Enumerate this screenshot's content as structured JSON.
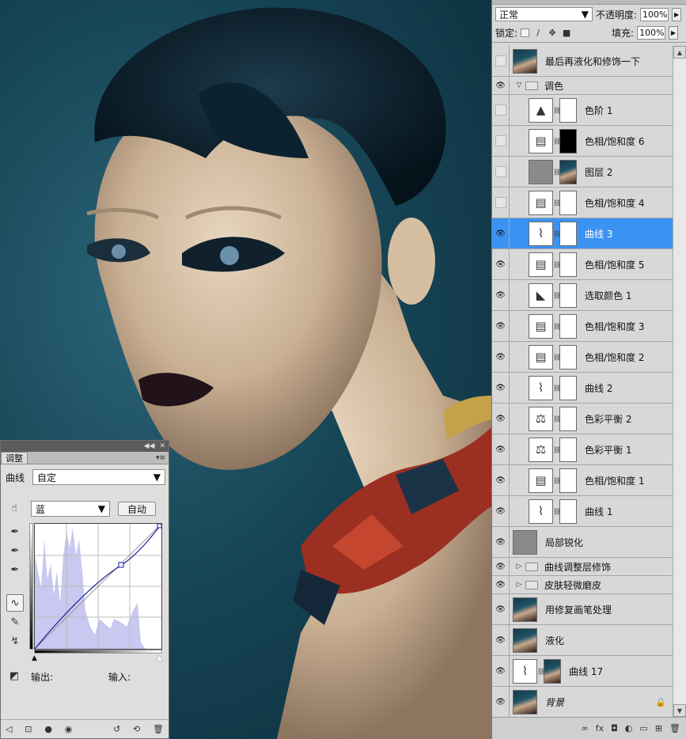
{
  "layers_panel": {
    "blend_mode": "正常",
    "opacity_label": "不透明度:",
    "opacity_value": "100%",
    "lock_label": "锁定:",
    "fill_label": "填充:",
    "fill_value": "100%",
    "layers": [
      {
        "name": "最后再液化和修饰一下",
        "visible": false,
        "kind": "photo"
      },
      {
        "name": "调色",
        "visible": true,
        "kind": "group-open"
      },
      {
        "name": "色阶 1",
        "visible": false,
        "kind": "levels",
        "in_group": true
      },
      {
        "name": "色相/饱和度 6",
        "visible": false,
        "kind": "hue",
        "in_group": true,
        "mask": "black"
      },
      {
        "name": "图层 2",
        "visible": false,
        "kind": "gray",
        "in_group": true,
        "mask": "photo"
      },
      {
        "name": "色相/饱和度 4",
        "visible": false,
        "kind": "hue",
        "in_group": true,
        "mask": "white"
      },
      {
        "name": "曲线 3",
        "visible": true,
        "kind": "curves",
        "in_group": true,
        "selected": true
      },
      {
        "name": "色相/饱和度 5",
        "visible": true,
        "kind": "hue",
        "in_group": true
      },
      {
        "name": "选取颜色 1",
        "visible": true,
        "kind": "selective",
        "in_group": true
      },
      {
        "name": "色相/饱和度 3",
        "visible": true,
        "kind": "hue",
        "in_group": true
      },
      {
        "name": "色相/饱和度 2",
        "visible": true,
        "kind": "hue",
        "in_group": true
      },
      {
        "name": "曲线 2",
        "visible": true,
        "kind": "curves",
        "in_group": true
      },
      {
        "name": "色彩平衡 2",
        "visible": true,
        "kind": "balance",
        "in_group": true
      },
      {
        "name": "色彩平衡 1",
        "visible": true,
        "kind": "balance",
        "in_group": true
      },
      {
        "name": "色相/饱和度 1",
        "visible": true,
        "kind": "hue",
        "in_group": true
      },
      {
        "name": "曲线 1",
        "visible": true,
        "kind": "curves",
        "in_group": true
      },
      {
        "name": "局部锐化",
        "visible": true,
        "kind": "gray"
      },
      {
        "name": "曲线调整层修饰",
        "visible": true,
        "kind": "group-closed"
      },
      {
        "name": "皮肤轻微磨皮",
        "visible": true,
        "kind": "group-closed"
      },
      {
        "name": "用修复画笔处理",
        "visible": true,
        "kind": "photo"
      },
      {
        "name": "液化",
        "visible": true,
        "kind": "photo"
      },
      {
        "name": "曲线 17",
        "visible": true,
        "kind": "curves",
        "mask": "photo"
      },
      {
        "name": "背景",
        "visible": true,
        "kind": "photo",
        "locked": true
      }
    ]
  },
  "adjustments_panel": {
    "tab_label": "调整",
    "type_label": "曲线",
    "preset_value": "自定",
    "channel_value": "蓝",
    "auto_label": "自动",
    "output_label": "输出:",
    "input_label": "输入:"
  },
  "colors": {
    "selection": "#3a93f3",
    "panel_bg": "#d8d8d8",
    "curve_line": "#1a1aa0",
    "histogram": "#c8c8f0"
  },
  "icons": [
    "eye-icon",
    "chain-icon",
    "folder-icon",
    "lock-icon",
    "fx-icon",
    "trash-icon",
    "new-layer-icon",
    "mask-icon",
    "adjustment-icon",
    "pencil-icon",
    "eyedropper-icon",
    "curve-tool-icon",
    "target-adjust-icon"
  ]
}
